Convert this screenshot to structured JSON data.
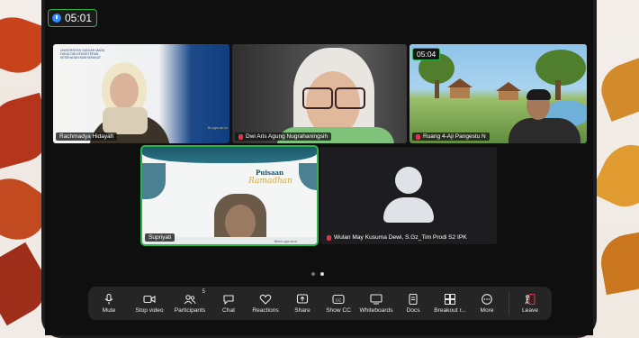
{
  "meeting_timer": "05:01",
  "tiles": [
    {
      "name": "Rachmadya Hidayah",
      "muted": false,
      "header_text": "UNIVERSITAS GADJAH MADA FAKULTAS KEDOKTERAN KESEHATAN MASYARAKAT",
      "stamp": "fk.ugm.ac.id"
    },
    {
      "name": "Dwi Aris Agung Nugrahaningsih",
      "muted": true
    },
    {
      "name": "Ruang 4-Aji Pangestu N",
      "muted": true,
      "overlay_timer": "05:04"
    },
    {
      "name": "Supriyati",
      "muted": false,
      "slide_title_top": "Puisaan",
      "slide_title_bottom": "Ramadhan",
      "footer": "fkkmk.ugm.ac.id"
    },
    {
      "name": "Wulan May Kusuma Dewi, S.Gz_Tim Prodi S2 IPK",
      "muted": true
    }
  ],
  "toolbar": {
    "items": [
      {
        "key": "mute",
        "label": "Mute",
        "icon": "mic-icon"
      },
      {
        "key": "video",
        "label": "Stop video",
        "icon": "video-camera-icon"
      },
      {
        "key": "participants",
        "label": "Participants",
        "icon": "participants-icon",
        "badge": "5"
      },
      {
        "key": "chat",
        "label": "Chat",
        "icon": "chat-icon"
      },
      {
        "key": "reactions",
        "label": "Reactions",
        "icon": "heart-icon"
      },
      {
        "key": "share",
        "label": "Share",
        "icon": "share-screen-icon"
      },
      {
        "key": "showcc",
        "label": "Show CC",
        "icon": "closed-caption-icon"
      },
      {
        "key": "whiteboards",
        "label": "Whiteboards",
        "icon": "whiteboard-icon"
      },
      {
        "key": "docs",
        "label": "Docs",
        "icon": "document-icon"
      },
      {
        "key": "breakout",
        "label": "Breakout r...",
        "icon": "breakout-rooms-icon"
      },
      {
        "key": "more",
        "label": "More",
        "icon": "more-icon"
      },
      {
        "key": "leave",
        "label": "Leave",
        "icon": "leave-icon"
      }
    ]
  },
  "colors": {
    "accent_green": "#2bb64b",
    "leave_red": "#e0334d",
    "toolbar_bg": "#252525"
  }
}
